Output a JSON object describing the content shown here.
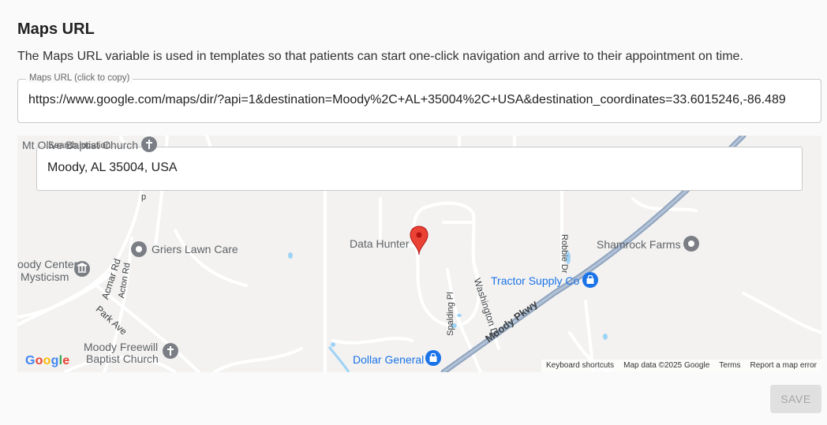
{
  "header": {
    "title": "Maps URL",
    "description": "The Maps URL variable is used in templates so that patients can start one-click navigation and arrive to their appointment on time."
  },
  "url_field": {
    "label": "Maps URL (click to copy)",
    "value": "https://www.google.com/maps/dir/?api=1&destination=Moody%2C+AL+35004%2C+USA&destination_coordinates=33.6015246,-86.489"
  },
  "map": {
    "search": {
      "label": "Search location",
      "value": "Moody, AL 35004, USA"
    },
    "pois": {
      "mt_olive": "Mt Olive Baptist Church",
      "griers": "Griers Lawn Care",
      "moody_center_1": "oody Center",
      "moody_center_2": "Mysticism",
      "data_hunter": "Data Hunter",
      "shamrock": "Shamrock Farms",
      "tractor_supply": "Tractor Supply Co",
      "moody_freewill_1": "Moody Freewill",
      "moody_freewill_2": "Baptist Church",
      "dollar_general": "Dollar General"
    },
    "roads": {
      "acmar": "Acmar Rd",
      "acton": "Acton Rd",
      "park": "Park Ave",
      "spalding": "Spalding Pl",
      "washington": "Washington Dr",
      "robbie": "Robbie Dr",
      "moody_pkwy": "Moody Pkwy",
      "edge_p": "p"
    },
    "google_logo": "Google",
    "attribution": {
      "keyboard": "Keyboard shortcuts",
      "map_data": "Map data ©2025 Google",
      "terms": "Terms",
      "report": "Report a map error"
    }
  },
  "actions": {
    "save_label": "SAVE"
  },
  "colors": {
    "pin_red": "#ea4335",
    "poi_blue": "#1a73e8",
    "poi_grey": "#7b7f85",
    "highway": "#8fa4bf"
  }
}
